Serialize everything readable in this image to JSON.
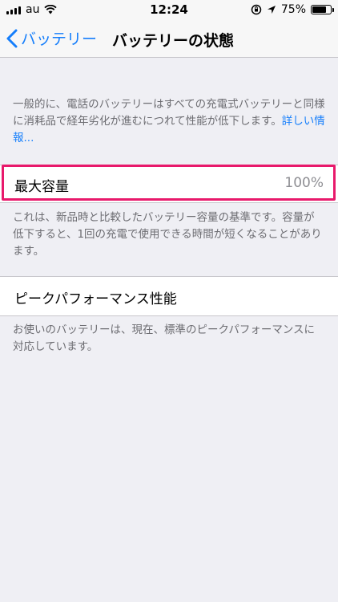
{
  "status_bar": {
    "carrier": "au",
    "time": "12:24",
    "battery_text": "75%",
    "battery_level": 0.75,
    "icons": [
      "signal-bars",
      "wifi-icon",
      "rotation-lock-icon",
      "location-arrow-icon",
      "battery-icon"
    ]
  },
  "nav": {
    "back_label": "バッテリー",
    "title": "バッテリーの状態"
  },
  "intro": {
    "text": "一般的に、電話のバッテリーはすべての充電式バッテリーと同様に消耗品で経年劣化が進むにつれて性能が低下します。",
    "link": "詳しい情報..."
  },
  "max_capacity": {
    "label": "最大容量",
    "value": "100%",
    "footer": "これは、新品時と比較したバッテリー容量の基準です。容量が低下すると、1回の充電で使用できる時間が短くなることがあります。"
  },
  "peak_performance": {
    "label": "ピークパフォーマンス性能",
    "footer": "お使いのバッテリーは、現在、標準のピークパフォーマンスに対応しています。"
  },
  "colors": {
    "accent": "#157efb",
    "highlight": "#e8196b",
    "background": "#efeff4"
  }
}
